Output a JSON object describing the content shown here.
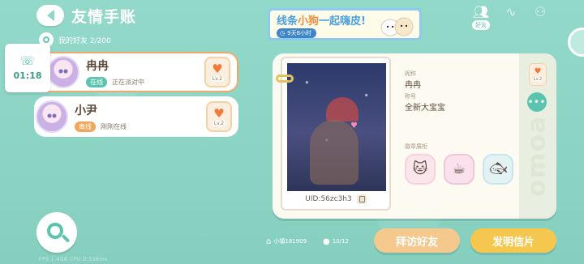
{
  "header": {
    "title": "友情手账",
    "friends_count_label": "我的好友 2/200"
  },
  "call": {
    "time": "01:18"
  },
  "friends": [
    {
      "name": "冉冉",
      "status_badge": "在线",
      "status_text": "正在派对中",
      "level": "Lv.2"
    },
    {
      "name": "小尹",
      "status_badge": "离线",
      "status_text": "刚刚在线",
      "level": "Lv.2"
    }
  ],
  "banner": {
    "title_part1": "线条",
    "title_highlight": "小狗",
    "title_part2": "一起嗨皮!",
    "timer": "9天8小时"
  },
  "tabs": [
    {
      "icon": "friends-icon",
      "label": "好友",
      "active": true
    },
    {
      "icon": "heartbeat-icon",
      "label": "",
      "active": false
    },
    {
      "icon": "contacts-icon",
      "label": "",
      "active": false
    }
  ],
  "profile": {
    "nickname_label": "昵称",
    "nickname": "冉冉",
    "title_label": "称号",
    "title": "全新大宝宝",
    "badges_label": "徽章展柜",
    "uid": "UID:56zc3h3",
    "level": "Lv.2",
    "side_watermark": "ɐoɯo",
    "more_label": "•••"
  },
  "stats": {
    "town": "小镇181909",
    "visitors": "10/12"
  },
  "actions": {
    "visit": "拜访好友",
    "postcard": "发明信片"
  },
  "footer": "FPS  1.4GB  CPU  D:526ms"
}
